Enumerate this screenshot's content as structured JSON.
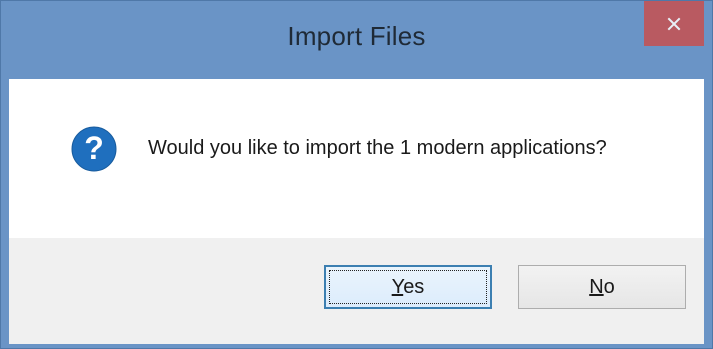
{
  "window": {
    "title": "Import Files",
    "close_icon": "close-icon"
  },
  "message": {
    "icon": "question-icon",
    "text": "Would you like to import the 1 modern applications?"
  },
  "buttons": {
    "yes": {
      "mnemonic": "Y",
      "rest": "es",
      "label": "Yes"
    },
    "no": {
      "mnemonic": "N",
      "rest": "o",
      "label": "No"
    }
  },
  "colors": {
    "titlebar": "#6a94c6",
    "close_button": "#c75050",
    "icon_blue": "#1f6fbe",
    "default_button_border": "#3c7fb1"
  }
}
